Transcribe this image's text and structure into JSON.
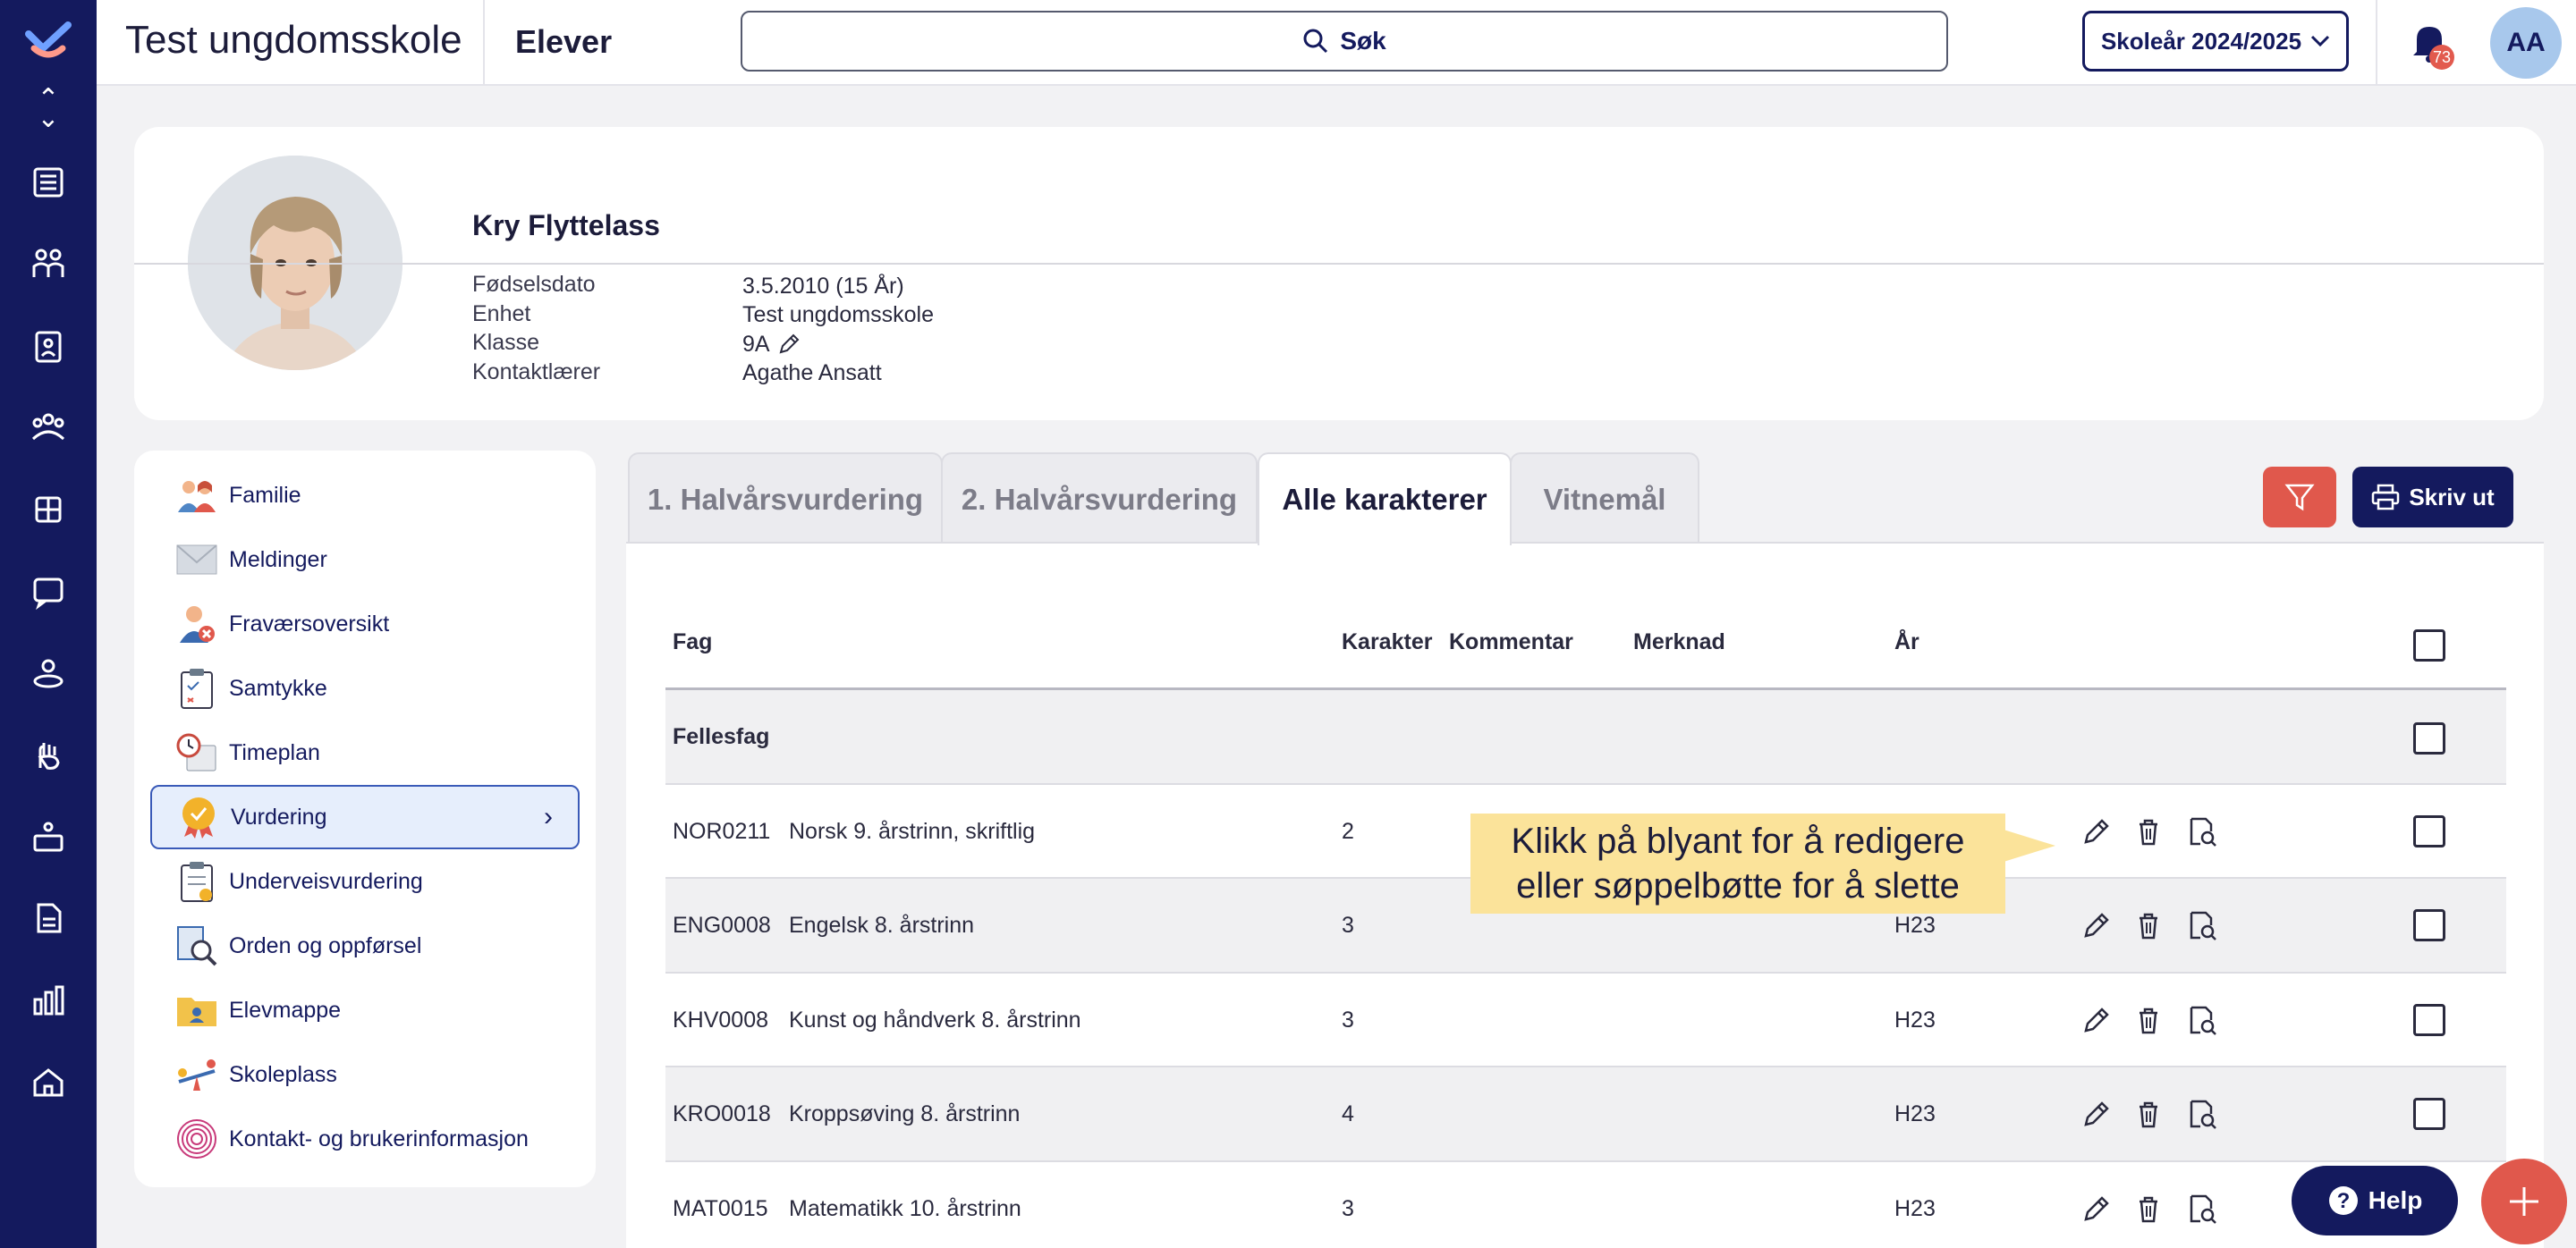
{
  "header": {
    "school": "Test ungdomsskole",
    "page": "Elever",
    "search_label": "Søk",
    "school_year": "Skoleår 2024/2025",
    "notification_count": "73",
    "user_initials": "AA"
  },
  "student": {
    "name": "Kry Flyttelass",
    "fields": [
      {
        "label": "Fødselsdato",
        "value": "3.5.2010 (15 År)"
      },
      {
        "label": "Enhet",
        "value": "Test ungdomsskole"
      },
      {
        "label": "Klasse",
        "value": "9A"
      },
      {
        "label": "Kontaktlærer",
        "value": "Agathe Ansatt"
      }
    ]
  },
  "menu": [
    {
      "label": "Familie",
      "icon": "family-icon"
    },
    {
      "label": "Meldinger",
      "icon": "envelope-icon"
    },
    {
      "label": "Fraværsoversikt",
      "icon": "absence-icon"
    },
    {
      "label": "Samtykke",
      "icon": "clipboard-icon"
    },
    {
      "label": "Timeplan",
      "icon": "schedule-icon"
    },
    {
      "label": "Vurdering",
      "icon": "medal-icon",
      "active": true
    },
    {
      "label": "Underveisvurdering",
      "icon": "clipboard-badge-icon"
    },
    {
      "label": "Orden og oppførsel",
      "icon": "magnifier-doc-icon"
    },
    {
      "label": "Elevmappe",
      "icon": "folder-icon"
    },
    {
      "label": "Skoleplass",
      "icon": "seesaw-icon"
    },
    {
      "label": "Kontakt- og brukerinformasjon",
      "icon": "fingerprint-icon"
    }
  ],
  "tabs": [
    "1. Halvårsvurdering",
    "2. Halvårsvurdering",
    "Alle karakterer",
    "Vitnemål"
  ],
  "active_tab": "Alle karakterer",
  "print_label": "Skriv ut",
  "table": {
    "headers": {
      "fag": "Fag",
      "karakter": "Karakter",
      "kommentar": "Kommentar",
      "merknad": "Merknad",
      "ar": "År"
    },
    "group": "Fellesfag",
    "rows": [
      {
        "code": "NOR0211",
        "subject": "Norsk 9. årstrinn, skriftlig",
        "grade": "2",
        "year": ""
      },
      {
        "code": "ENG0008",
        "subject": "Engelsk 8. årstrinn",
        "grade": "3",
        "year": "H23"
      },
      {
        "code": "KHV0008",
        "subject": "Kunst og håndverk 8. årstrinn",
        "grade": "3",
        "year": "H23"
      },
      {
        "code": "KRO0018",
        "subject": "Kroppsøving 8. årstrinn",
        "grade": "4",
        "year": "H23"
      },
      {
        "code": "MAT0015",
        "subject": "Matematikk 10. årstrinn",
        "grade": "3",
        "year": "H23"
      }
    ]
  },
  "tooltip": {
    "line1": "Klikk på blyant for å redigere",
    "line2": "eller søppelbøtte for å slette"
  },
  "help_label": "Help",
  "colors": {
    "navy": "#141a5e",
    "accent_red": "#e0584c",
    "tooltip": "#fbe39a"
  }
}
